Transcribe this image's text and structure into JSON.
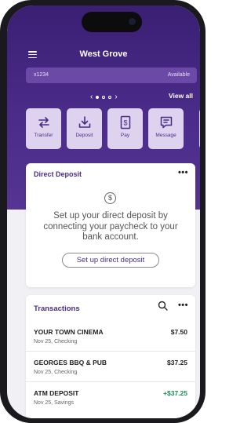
{
  "app": {
    "title": "West Grove"
  },
  "account_card": {
    "number": "x1234",
    "available_label": "Available"
  },
  "pager": {
    "prev": "‹",
    "next": "›"
  },
  "view_all": "View all",
  "actions": [
    {
      "label": "Transfer",
      "icon": "transfer-icon"
    },
    {
      "label": "Deposit",
      "icon": "deposit-icon"
    },
    {
      "label": "Pay",
      "icon": "pay-icon"
    },
    {
      "label": "Message",
      "icon": "message-icon"
    }
  ],
  "direct_deposit": {
    "title": "Direct Deposit",
    "more": "•••",
    "icon_glyph": "$",
    "message": "Set up your direct deposit by connecting your paycheck to your bank account.",
    "button_label": "Set up direct deposit"
  },
  "transactions": {
    "title": "Transactions",
    "more": "•••",
    "items": [
      {
        "merchant": "YOUR TOWN CINEMA",
        "meta": "Nov 25, Checking",
        "amount": "$7.50"
      },
      {
        "merchant": "GEORGES BBQ & PUB",
        "meta": "Nov 25, Checking",
        "amount": "$37.25"
      },
      {
        "merchant": "ATM DEPOSIT",
        "meta": "Nov 25, Savings",
        "amount": "+$37.25"
      }
    ]
  },
  "colors": {
    "brand": "#4b2c8a",
    "action_bg": "#ddd3ee",
    "credit": "#1d8a5a"
  }
}
